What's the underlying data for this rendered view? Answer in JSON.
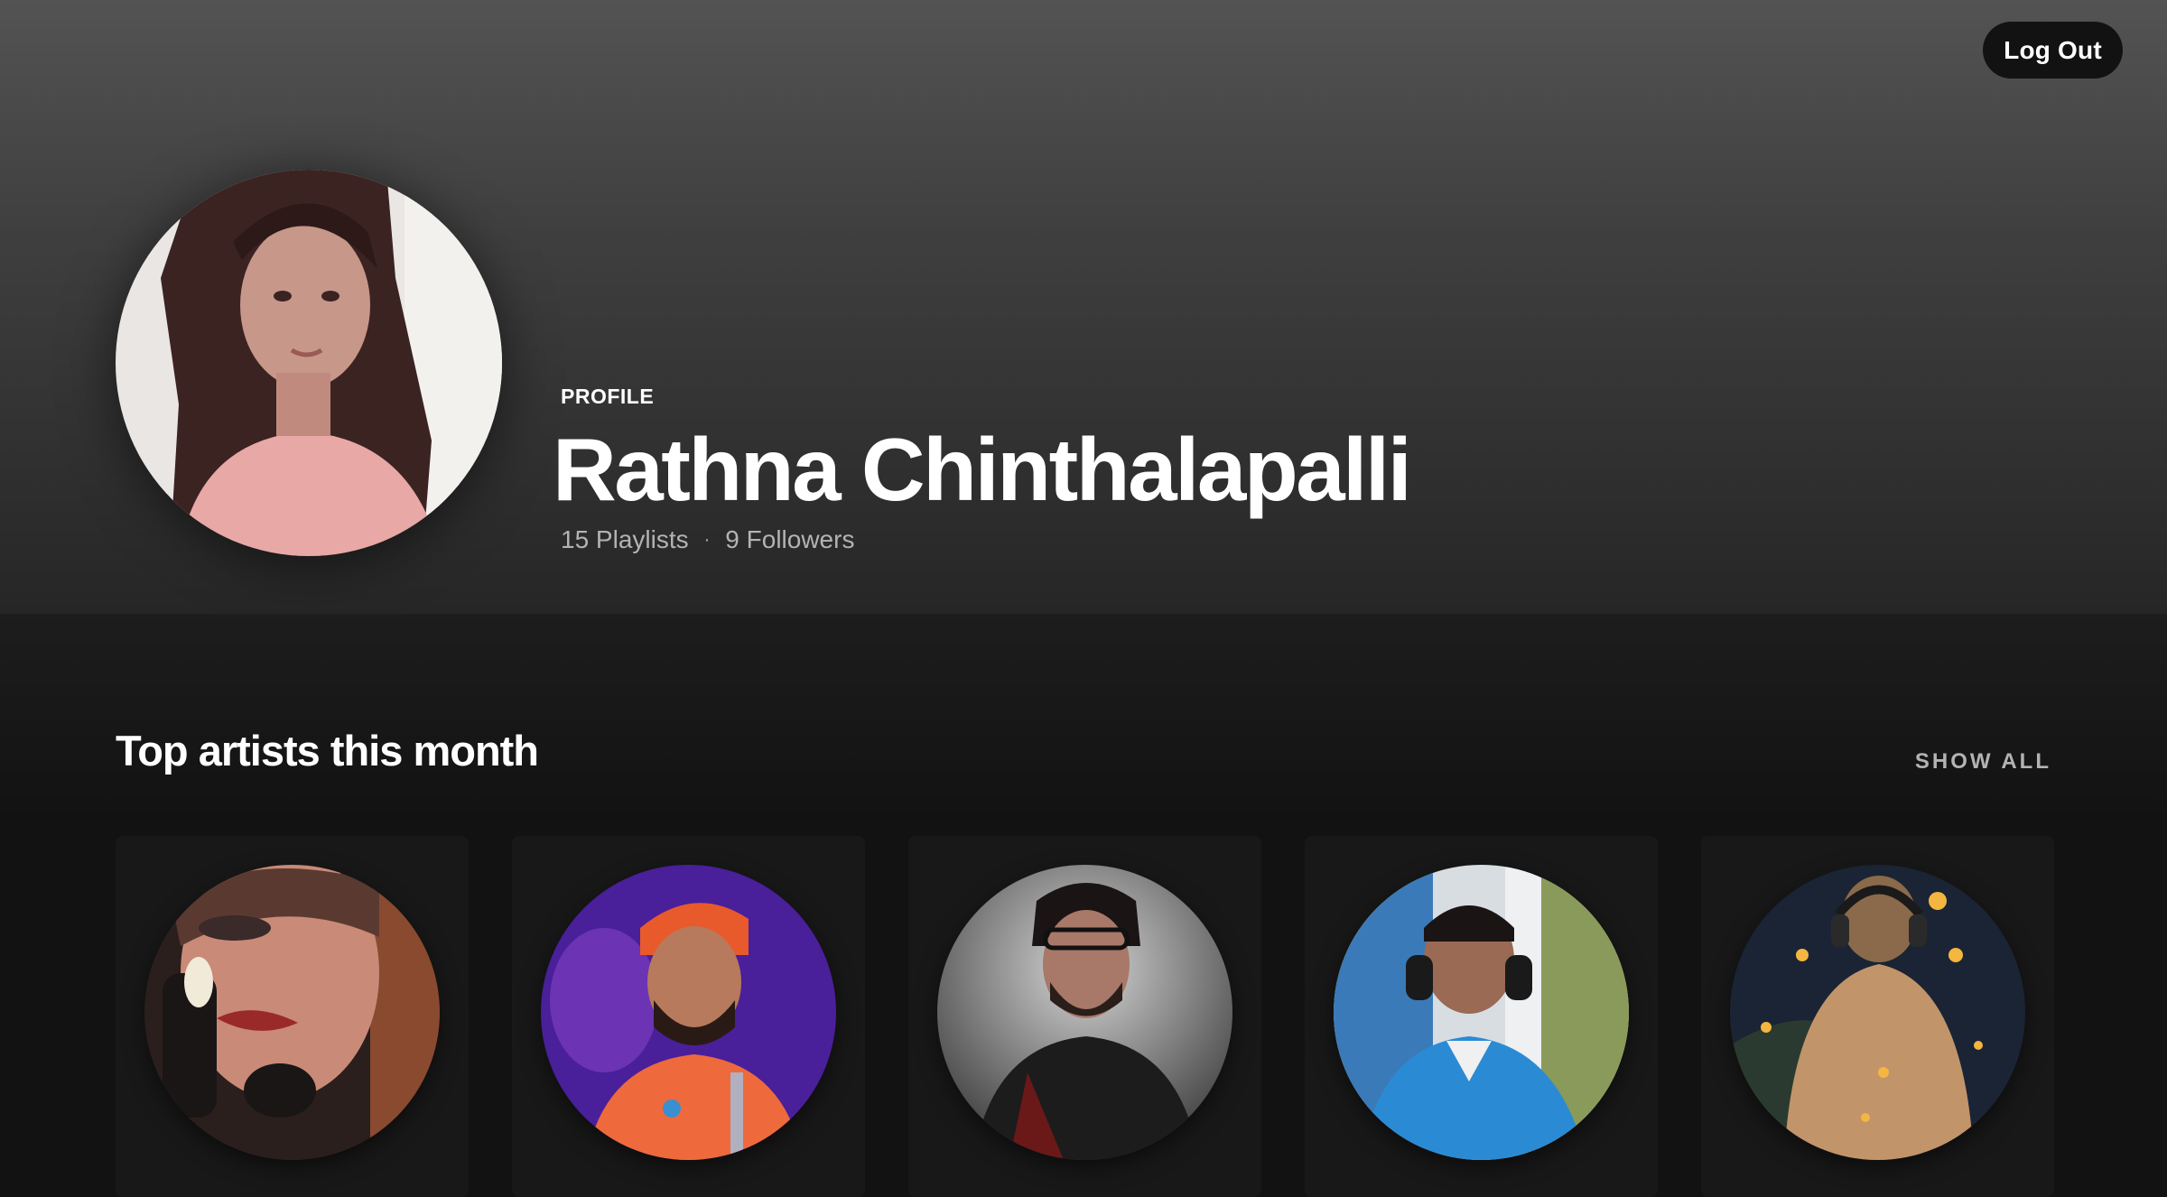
{
  "header": {
    "logout_label": "Log Out",
    "profile_label": "PROFILE",
    "name": "Rathna Chinthalapalli",
    "playlists": "15 Playlists",
    "separator": "·",
    "followers": "9 Followers"
  },
  "top_artists": {
    "title": "Top artists this month",
    "show_all_label": "SHOW ALL",
    "artists": [
      {
        "image": "artist-portrait-1",
        "colors": [
          "#3a2a25",
          "#c98a78"
        ]
      },
      {
        "image": "artist-portrait-2",
        "colors": [
          "#4a1f9a",
          "#ee6a3c"
        ]
      },
      {
        "image": "artist-portrait-3",
        "colors": [
          "#5a5a5a",
          "#1c1c1c"
        ]
      },
      {
        "image": "artist-portrait-4",
        "colors": [
          "#6f8fb0",
          "#2a8bd4"
        ]
      },
      {
        "image": "artist-portrait-5",
        "colors": [
          "#1a2a3a",
          "#c2946a"
        ]
      }
    ]
  },
  "colors": {
    "background": "#121212",
    "card": "#181818",
    "muted_text": "#b3b3b3"
  }
}
